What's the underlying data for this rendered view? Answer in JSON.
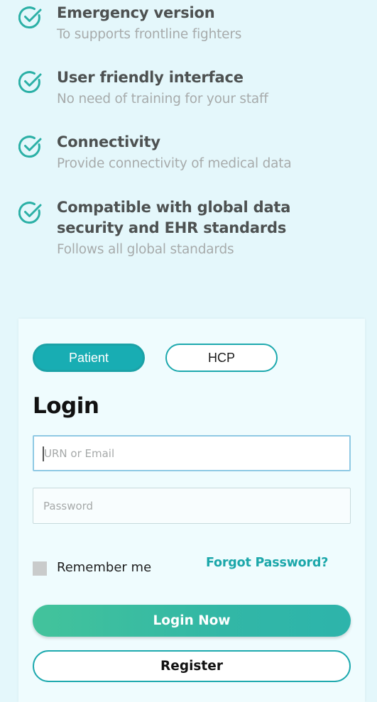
{
  "features": [
    {
      "title": "Emergency version",
      "subtitle": "To supports frontline fighters"
    },
    {
      "title": "User friendly interface",
      "subtitle": "No need of training for your staff"
    },
    {
      "title": "Connectivity",
      "subtitle": "Provide connectivity of medical data"
    },
    {
      "title": "Compatible with global data security and EHR standards",
      "subtitle": "Follows all global standards"
    }
  ],
  "login": {
    "roles": {
      "patient": "Patient",
      "hcp": "HCP"
    },
    "selected_role": "Patient",
    "title": "Login",
    "email_placeholder": "URN or Email",
    "password_placeholder": "Password",
    "remember_label": "Remember me",
    "forgot_label": "Forgot Password?",
    "login_button": "Login Now",
    "register_button": "Register"
  },
  "colors": {
    "accent": "#1ba7aa",
    "background": "#e4f7fb",
    "check_icon": "#2bb0a6"
  },
  "icons": {
    "feature_icon": "check-circle-icon"
  }
}
